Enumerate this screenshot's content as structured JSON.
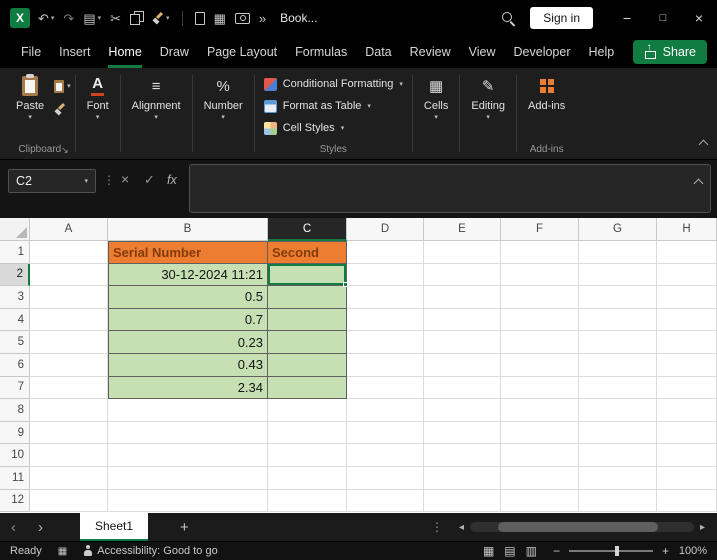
{
  "titlebar": {
    "workbook_title": "Book...",
    "signin_label": "Sign in"
  },
  "menubar": {
    "items": [
      "File",
      "Insert",
      "Home",
      "Draw",
      "Page Layout",
      "Formulas",
      "Data",
      "Review",
      "View",
      "Developer",
      "Help"
    ],
    "active_item": "Home",
    "share_label": "Share"
  },
  "ribbon": {
    "paste_label": "Paste",
    "clipboard_group": "Clipboard",
    "font_button": "Font",
    "alignment_button": "Alignment",
    "number_button": "Number",
    "conditional_formatting": "Conditional Formatting",
    "format_as_table": "Format as Table",
    "cell_styles": "Cell Styles",
    "styles_group": "Styles",
    "cells_button": "Cells",
    "editing_button": "Editing",
    "addins_button": "Add-ins",
    "addins_group": "Add-ins"
  },
  "formula": {
    "name_box": "C2"
  },
  "grid": {
    "columns": [
      "A",
      "B",
      "C",
      "D",
      "E",
      "F",
      "G",
      "H"
    ],
    "row_count": 12,
    "selected_column": "C",
    "selected_row": "2",
    "active_cell": "C2",
    "cells": [
      {
        "ref": "B1",
        "text": "Serial Number",
        "style": "orange"
      },
      {
        "ref": "C1",
        "text": "Second",
        "style": "orange"
      },
      {
        "ref": "B2",
        "text": "30-12-2024 11:21",
        "style": "green"
      },
      {
        "ref": "C2",
        "text": "",
        "style": "green"
      },
      {
        "ref": "B3",
        "text": "0.5",
        "style": "green"
      },
      {
        "ref": "C3",
        "text": "",
        "style": "green"
      },
      {
        "ref": "B4",
        "text": "0.7",
        "style": "green"
      },
      {
        "ref": "C4",
        "text": "",
        "style": "green"
      },
      {
        "ref": "B5",
        "text": "0.23",
        "style": "green"
      },
      {
        "ref": "C5",
        "text": "",
        "style": "green"
      },
      {
        "ref": "B6",
        "text": "0.43",
        "style": "green"
      },
      {
        "ref": "C6",
        "text": "",
        "style": "green"
      },
      {
        "ref": "B7",
        "text": "2.34",
        "style": "green"
      },
      {
        "ref": "C7",
        "text": "",
        "style": "green"
      }
    ]
  },
  "sheet_tabs": {
    "tabs": [
      "Sheet1"
    ],
    "active_tab": "Sheet1"
  },
  "status": {
    "ready_label": "Ready",
    "accessibility_label": "Accessibility: Good to go",
    "zoom_level": "100%"
  },
  "icons": {
    "logo_letter": "X",
    "undo": "↶",
    "redo": "↷",
    "chevron_down": "▾",
    "clipboard": "▤",
    "cut": "✂",
    "table": "▦",
    "overflow": "»",
    "minimize": "−",
    "maximize": "□",
    "close": "×",
    "dots": "⋮",
    "cancel": "×",
    "enter": "✓",
    "fx": "fx",
    "launcher": "↘",
    "font_a": "A",
    "alignment": "≡",
    "number_percent": "%",
    "cells": "▦",
    "editing": "✎",
    "nav_back": "‹",
    "nav_forward": "›",
    "add_sheet": "+",
    "scroll_left": "◂",
    "scroll_right": "▸",
    "macro": "▦",
    "view_normal": "▦",
    "view_layout": "▤",
    "view_break": "▥",
    "zoom_out": "−",
    "zoom_in": "+"
  },
  "colors": {
    "accent_green": "#107C41",
    "header_fill": "#ED7D31",
    "header_text": "#843C0C",
    "data_fill": "#C6E0B4",
    "addin_orange": "#ED7D31"
  }
}
